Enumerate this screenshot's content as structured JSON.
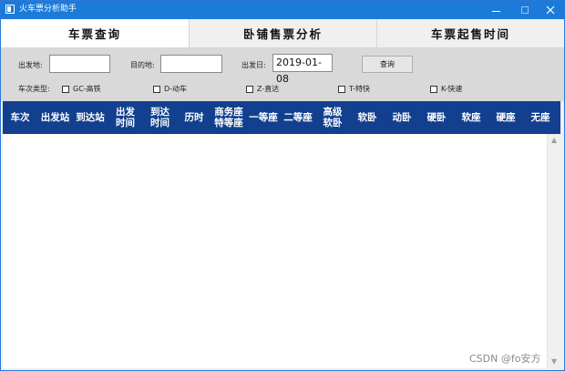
{
  "window": {
    "title": "火车票分析助手"
  },
  "tabs": [
    {
      "label": "车票查询",
      "selected": true
    },
    {
      "label": "卧铺售票分析",
      "selected": false
    },
    {
      "label": "车票起售时间",
      "selected": false
    }
  ],
  "form": {
    "from_label": "出发地:",
    "from_value": "",
    "to_label": "目的地:",
    "to_value": "",
    "date_label": "出发日:",
    "date_value": "2019-01-08",
    "query_label": "查询",
    "type_label": "车次类型:",
    "types": [
      {
        "label": "GC-高铁",
        "checked": false
      },
      {
        "label": "D-动车",
        "checked": false
      },
      {
        "label": "Z-直达",
        "checked": false
      },
      {
        "label": "T-特快",
        "checked": false
      },
      {
        "label": "K-快速",
        "checked": false
      }
    ]
  },
  "table": {
    "header_color": "#12408f",
    "columns": [
      "车次",
      "出发站",
      "到达站",
      "出发\n时间",
      "到达\n时间",
      "历时",
      "商务座\n特等座",
      "一等座",
      "二等座",
      "高级\n软卧",
      "软卧",
      "动卧",
      "硬卧",
      "软座",
      "硬座",
      "无座"
    ],
    "rows": []
  },
  "watermark": "CSDN @fo安方"
}
